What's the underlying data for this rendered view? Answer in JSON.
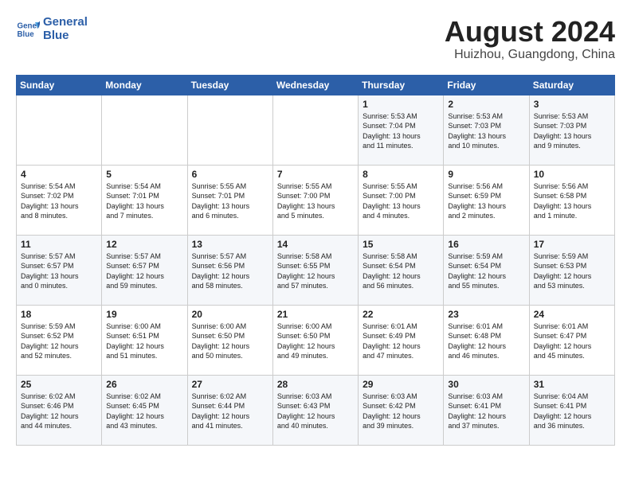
{
  "logo": {
    "line1": "General",
    "line2": "Blue"
  },
  "title": "August 2024",
  "location": "Huizhou, Guangdong, China",
  "headers": [
    "Sunday",
    "Monday",
    "Tuesday",
    "Wednesday",
    "Thursday",
    "Friday",
    "Saturday"
  ],
  "weeks": [
    [
      {
        "day": "",
        "info": ""
      },
      {
        "day": "",
        "info": ""
      },
      {
        "day": "",
        "info": ""
      },
      {
        "day": "",
        "info": ""
      },
      {
        "day": "1",
        "info": "Sunrise: 5:53 AM\nSunset: 7:04 PM\nDaylight: 13 hours\nand 11 minutes."
      },
      {
        "day": "2",
        "info": "Sunrise: 5:53 AM\nSunset: 7:03 PM\nDaylight: 13 hours\nand 10 minutes."
      },
      {
        "day": "3",
        "info": "Sunrise: 5:53 AM\nSunset: 7:03 PM\nDaylight: 13 hours\nand 9 minutes."
      }
    ],
    [
      {
        "day": "4",
        "info": "Sunrise: 5:54 AM\nSunset: 7:02 PM\nDaylight: 13 hours\nand 8 minutes."
      },
      {
        "day": "5",
        "info": "Sunrise: 5:54 AM\nSunset: 7:01 PM\nDaylight: 13 hours\nand 7 minutes."
      },
      {
        "day": "6",
        "info": "Sunrise: 5:55 AM\nSunset: 7:01 PM\nDaylight: 13 hours\nand 6 minutes."
      },
      {
        "day": "7",
        "info": "Sunrise: 5:55 AM\nSunset: 7:00 PM\nDaylight: 13 hours\nand 5 minutes."
      },
      {
        "day": "8",
        "info": "Sunrise: 5:55 AM\nSunset: 7:00 PM\nDaylight: 13 hours\nand 4 minutes."
      },
      {
        "day": "9",
        "info": "Sunrise: 5:56 AM\nSunset: 6:59 PM\nDaylight: 13 hours\nand 2 minutes."
      },
      {
        "day": "10",
        "info": "Sunrise: 5:56 AM\nSunset: 6:58 PM\nDaylight: 13 hours\nand 1 minute."
      }
    ],
    [
      {
        "day": "11",
        "info": "Sunrise: 5:57 AM\nSunset: 6:57 PM\nDaylight: 13 hours\nand 0 minutes."
      },
      {
        "day": "12",
        "info": "Sunrise: 5:57 AM\nSunset: 6:57 PM\nDaylight: 12 hours\nand 59 minutes."
      },
      {
        "day": "13",
        "info": "Sunrise: 5:57 AM\nSunset: 6:56 PM\nDaylight: 12 hours\nand 58 minutes."
      },
      {
        "day": "14",
        "info": "Sunrise: 5:58 AM\nSunset: 6:55 PM\nDaylight: 12 hours\nand 57 minutes."
      },
      {
        "day": "15",
        "info": "Sunrise: 5:58 AM\nSunset: 6:54 PM\nDaylight: 12 hours\nand 56 minutes."
      },
      {
        "day": "16",
        "info": "Sunrise: 5:59 AM\nSunset: 6:54 PM\nDaylight: 12 hours\nand 55 minutes."
      },
      {
        "day": "17",
        "info": "Sunrise: 5:59 AM\nSunset: 6:53 PM\nDaylight: 12 hours\nand 53 minutes."
      }
    ],
    [
      {
        "day": "18",
        "info": "Sunrise: 5:59 AM\nSunset: 6:52 PM\nDaylight: 12 hours\nand 52 minutes."
      },
      {
        "day": "19",
        "info": "Sunrise: 6:00 AM\nSunset: 6:51 PM\nDaylight: 12 hours\nand 51 minutes."
      },
      {
        "day": "20",
        "info": "Sunrise: 6:00 AM\nSunset: 6:50 PM\nDaylight: 12 hours\nand 50 minutes."
      },
      {
        "day": "21",
        "info": "Sunrise: 6:00 AM\nSunset: 6:50 PM\nDaylight: 12 hours\nand 49 minutes."
      },
      {
        "day": "22",
        "info": "Sunrise: 6:01 AM\nSunset: 6:49 PM\nDaylight: 12 hours\nand 47 minutes."
      },
      {
        "day": "23",
        "info": "Sunrise: 6:01 AM\nSunset: 6:48 PM\nDaylight: 12 hours\nand 46 minutes."
      },
      {
        "day": "24",
        "info": "Sunrise: 6:01 AM\nSunset: 6:47 PM\nDaylight: 12 hours\nand 45 minutes."
      }
    ],
    [
      {
        "day": "25",
        "info": "Sunrise: 6:02 AM\nSunset: 6:46 PM\nDaylight: 12 hours\nand 44 minutes."
      },
      {
        "day": "26",
        "info": "Sunrise: 6:02 AM\nSunset: 6:45 PM\nDaylight: 12 hours\nand 43 minutes."
      },
      {
        "day": "27",
        "info": "Sunrise: 6:02 AM\nSunset: 6:44 PM\nDaylight: 12 hours\nand 41 minutes."
      },
      {
        "day": "28",
        "info": "Sunrise: 6:03 AM\nSunset: 6:43 PM\nDaylight: 12 hours\nand 40 minutes."
      },
      {
        "day": "29",
        "info": "Sunrise: 6:03 AM\nSunset: 6:42 PM\nDaylight: 12 hours\nand 39 minutes."
      },
      {
        "day": "30",
        "info": "Sunrise: 6:03 AM\nSunset: 6:41 PM\nDaylight: 12 hours\nand 37 minutes."
      },
      {
        "day": "31",
        "info": "Sunrise: 6:04 AM\nSunset: 6:41 PM\nDaylight: 12 hours\nand 36 minutes."
      }
    ]
  ]
}
